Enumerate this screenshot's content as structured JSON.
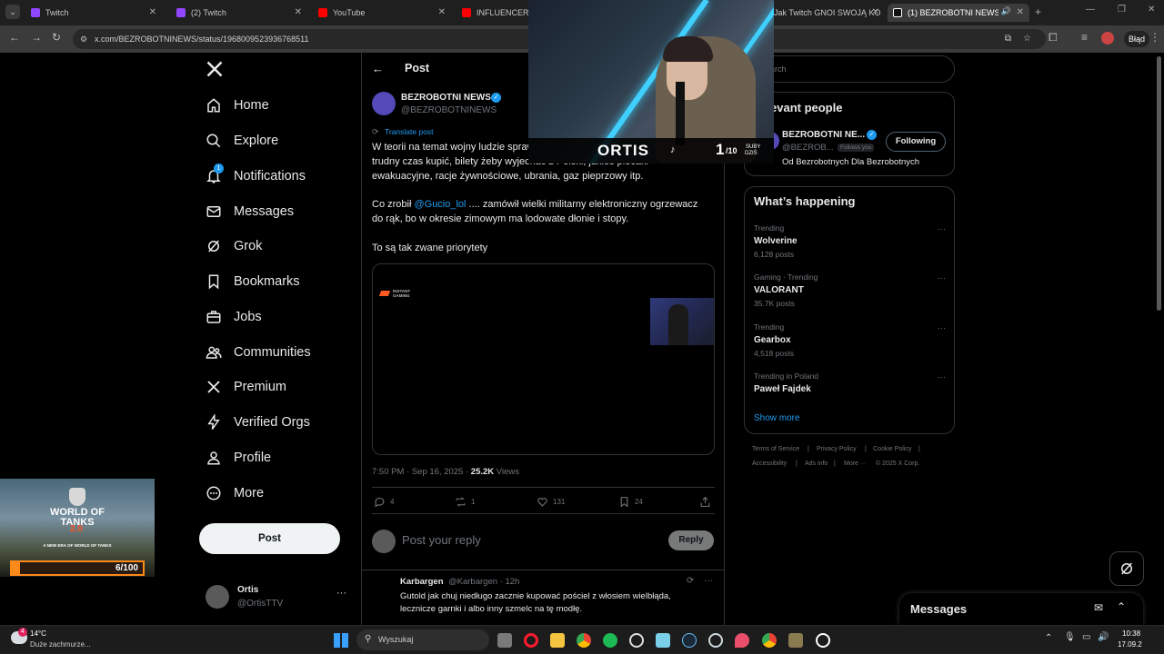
{
  "browser": {
    "tabs": [
      {
        "title": "Twitch",
        "color": "#9146ff"
      },
      {
        "title": "(2) Twitch",
        "color": "#9146ff"
      },
      {
        "title": "YouTube",
        "color": "#ff0000"
      },
      {
        "title": "INFLUENCERZY C",
        "color": "#ff0000"
      },
      {
        "title": "Jak Twitch GNOI SWOJĄ KO",
        "color": "#ff0000"
      },
      {
        "title": "(1) BEZROBOTNI NEWS on",
        "color": "#ffffff"
      }
    ],
    "url": "x.com/BEZROBOTNINEWS/status/1968009523936768511",
    "profile_label": "Błąd"
  },
  "sidebar": {
    "items": [
      {
        "label": "Home",
        "icon": "home-icon"
      },
      {
        "label": "Explore",
        "icon": "search-icon"
      },
      {
        "label": "Notifications",
        "icon": "bell-icon",
        "badge": "1"
      },
      {
        "label": "Messages",
        "icon": "mail-icon"
      },
      {
        "label": "Grok",
        "icon": "grok-icon"
      },
      {
        "label": "Bookmarks",
        "icon": "bookmark-icon"
      },
      {
        "label": "Jobs",
        "icon": "briefcase-icon"
      },
      {
        "label": "Communities",
        "icon": "people-icon"
      },
      {
        "label": "Premium",
        "icon": "x-logo-icon"
      },
      {
        "label": "Verified Orgs",
        "icon": "lightning-icon"
      },
      {
        "label": "Profile",
        "icon": "person-icon"
      },
      {
        "label": "More",
        "icon": "more-circle-icon"
      }
    ],
    "post_label": "Post",
    "account": {
      "name": "Ortis",
      "handle": "@OrtisTTV"
    }
  },
  "post": {
    "header": "Post",
    "author_name": "BEZROBOTNI NEWS",
    "author_handle": "@BEZROBOTNINEWS",
    "translate": "Translate post",
    "paragraph1_a": "W teorii na temat wojny ludzie sprawdzają wszy",
    "paragraph1_b": "trudny czas kupić, bilety żeby wyjechać z Polski, jakieś plecaki",
    "paragraph1_c": "ewakuacyjne, racje żywnościowe, ubrania, gaz pieprzowy itp.",
    "paragraph2_prefix": "Co zrobił ",
    "paragraph2_mention": "@Gucio_lol",
    "paragraph2_rest": " .... zamówił wielki militarny elektroniczny ogrzewacz",
    "paragraph2_b": "do rąk, bo w okresie zimowym ma lodowate dłonie i stopy.",
    "paragraph3": "To są tak zwane priorytety",
    "media_brand": "INSTANT GAMING",
    "timestamp": "7:50 PM · Sep 16, 2025 · ",
    "views_count": "25.2K",
    "views_label": " Views",
    "actions": {
      "replies": "4",
      "reposts": "1",
      "likes": "131",
      "bookmarks": "24"
    },
    "reply_placeholder": "Post your reply",
    "reply_button": "Reply"
  },
  "reply_item": {
    "name": "Karbargen",
    "handle": "@Karbargen · 12h",
    "text_a": "Gutold jak chuj niedługo zacznie kupować pościel z włosiem wielbłąda,",
    "text_b": "lecznicze garnki i albo inny szmelc na tę modłę."
  },
  "right": {
    "search_placeholder": "arch",
    "relevant_title": "evant people",
    "relevant_name": "BEZROBOTNI NE...",
    "relevant_handle": "@BEZROB...",
    "follows_you": "Follows you",
    "following_button": "Following",
    "relevant_bio": "Od Bezrobotnych Dla Bezrobotnych",
    "happening_title": "What’s happening",
    "trends": [
      {
        "meta": "Trending",
        "name": "Wolverine",
        "count": "6,128 posts"
      },
      {
        "meta": "Gaming · Trending",
        "name": "VALORANT",
        "count": "35.7K posts"
      },
      {
        "meta": "Trending",
        "name": "Gearbox",
        "count": "4,518 posts"
      },
      {
        "meta": "Trending in Poland",
        "name": "Paweł Fajdek",
        "count": ""
      }
    ],
    "show_more": "Show more",
    "footer": [
      "Terms of Service",
      "Privacy Policy",
      "Cookie Policy",
      "Accessibility",
      "Ads info",
      "More ···",
      "© 2025 X Corp."
    ],
    "messages_title": "Messages"
  },
  "overlay": {
    "stream_name": "ORTIS",
    "sub_count": "1",
    "sub_goal": "/10",
    "sub_label_a": "SUBY",
    "sub_label_b": "DZIŚ",
    "wot_title": "WORLD OF TANKS",
    "wot_version": "2.0",
    "wot_tagline": "A NEW ERA OF WORLD OF TANKS",
    "wot_progress": "6/100",
    "wot_progress_fraction": 0.06
  },
  "taskbar": {
    "weather_temp": "14°C",
    "weather_desc": "Duże zachmurze...",
    "weather_badge": "4",
    "search_placeholder": "Wyszukaj",
    "time": "10:38",
    "date": "17.09.2"
  }
}
